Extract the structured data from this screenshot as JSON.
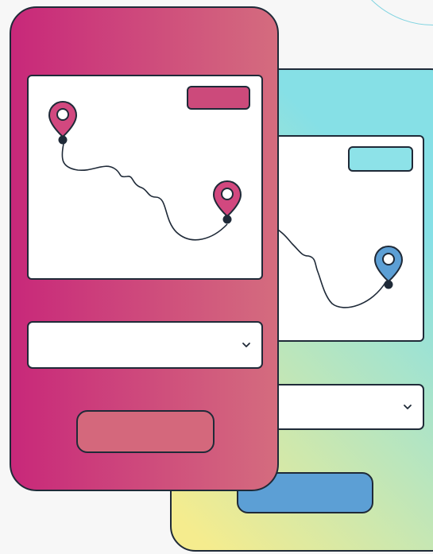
{
  "colors": {
    "front_gradient_start": "#c8287a",
    "front_gradient_end": "#d46c7e",
    "back_gradient_yellow": "#f5ec8e",
    "back_gradient_cyan": "#86e0e6",
    "front_chip": "#cc4a7b",
    "back_chip": "#8de2e8",
    "front_button": "#d4687c",
    "back_button": "#5c9fd5",
    "pin_front": "#d2487f",
    "pin_back": "#5c9fd5",
    "outline": "#1f2a38",
    "circle_outline": "#7fd3e0"
  },
  "front_phone": {
    "chip_label": "",
    "select_value": "",
    "button_label": ""
  },
  "back_phone": {
    "chip_label": "",
    "select_value": "",
    "button_label": ""
  },
  "icons": {
    "origin_pin": "map-pin-icon",
    "destination_pin": "map-pin-icon",
    "dropdown": "chevron-down-icon"
  }
}
